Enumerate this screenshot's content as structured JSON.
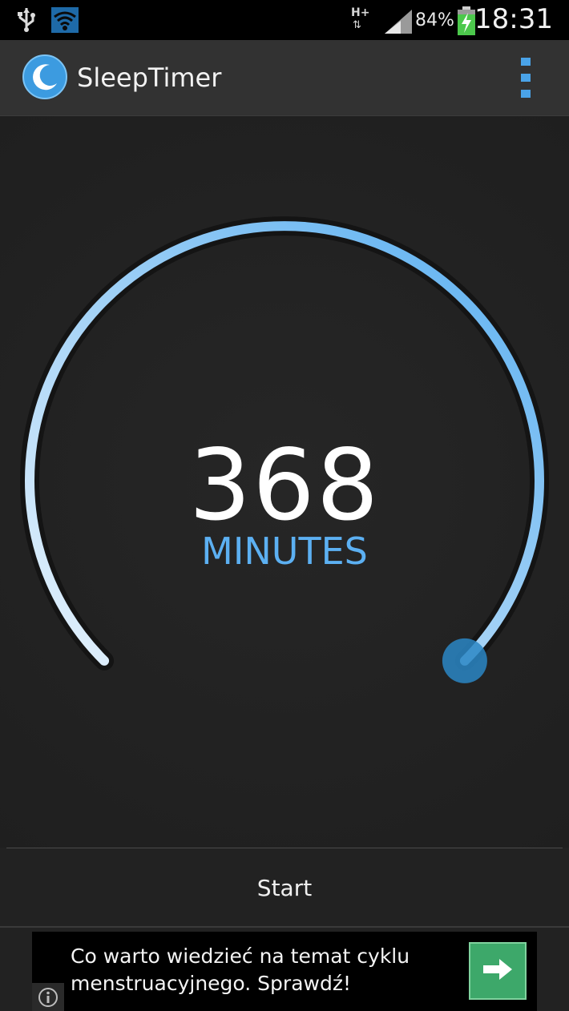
{
  "status_bar": {
    "network_type": "H+",
    "network_arrows": "⇅",
    "battery_percent": "84%",
    "time": "18:31",
    "icons": [
      "usb-icon",
      "wifi-icon",
      "signal-icon",
      "battery-charging-icon"
    ]
  },
  "app_bar": {
    "title": "SleepTimer",
    "logo_icon": "moon-icon",
    "menu_icon": "overflow-menu-icon",
    "accent_color": "#4aa3e8"
  },
  "timer": {
    "value": "368",
    "unit": "MINUTES",
    "arc_color_start": "#e6f2fc",
    "arc_color_end": "#58aef0",
    "handle_color": "#2a86c4"
  },
  "start_button": {
    "label": "Start"
  },
  "ad": {
    "text": "Co warto wiedzieć na temat cyklu menstruacyjnego. Sprawdź!",
    "arrow_icon": "arrow-right-icon",
    "info_icon": "info-icon",
    "button_color": "#3da86a"
  }
}
